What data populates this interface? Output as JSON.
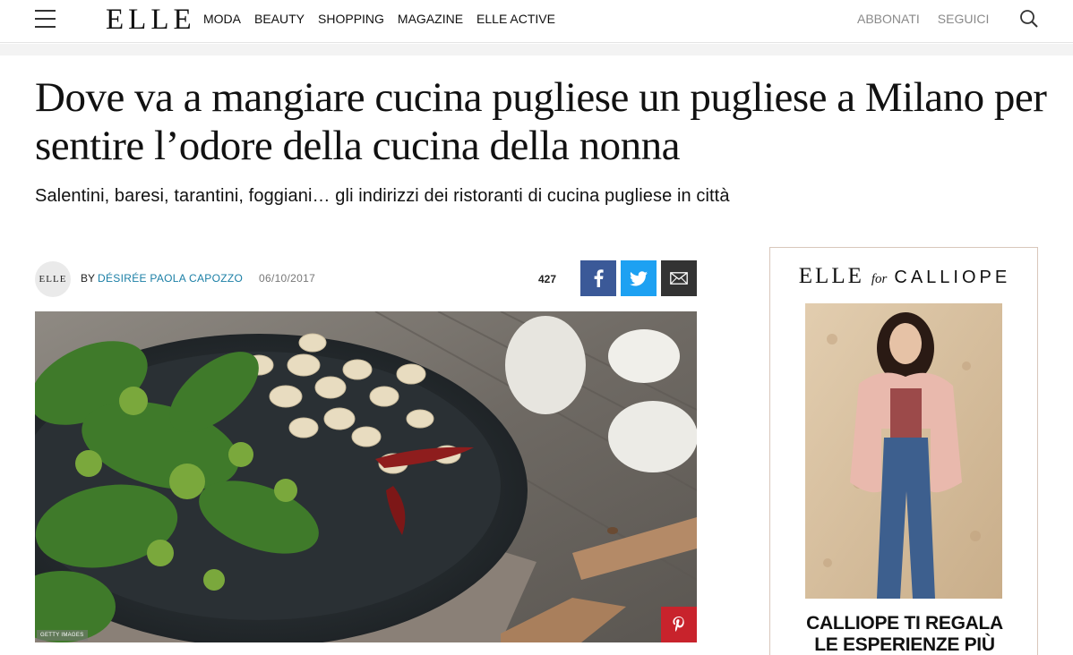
{
  "header": {
    "logo": "ELLE",
    "nav": [
      "MODA",
      "BEAUTY",
      "SHOPPING",
      "MAGAZINE",
      "ELLE ACTIVE"
    ],
    "nav_right": [
      "ABBONATI",
      "SEGUICI"
    ]
  },
  "article": {
    "title": "Dove va a mangiare cucina pugliese un pugliese a Milano per sentire l’odore della cucina della nonna",
    "subtitle": "Salentini, baresi, tarantini, foggiani… gli indirizzi dei ristoranti di cucina pugliese in città",
    "avatar_text": "ELLE",
    "by_label": "BY",
    "author": "DÉSIRÉE PAOLA CAPOZZO",
    "date": "06/10/2017",
    "share_count": "427",
    "image_credit": "GETTY IMAGES"
  },
  "ad": {
    "brand_elle": "ELLE",
    "brand_for": "for",
    "brand_partner": "CALLIOPE",
    "text_line1": "CALLIOPE TI REGALA",
    "text_line2": "LE ESPERIENZE PIÙ"
  },
  "colors": {
    "facebook": "#3b5998",
    "twitter": "#1da1f2",
    "email": "#333333",
    "pinterest": "#c8232c",
    "author_link": "#1b7fa6"
  }
}
